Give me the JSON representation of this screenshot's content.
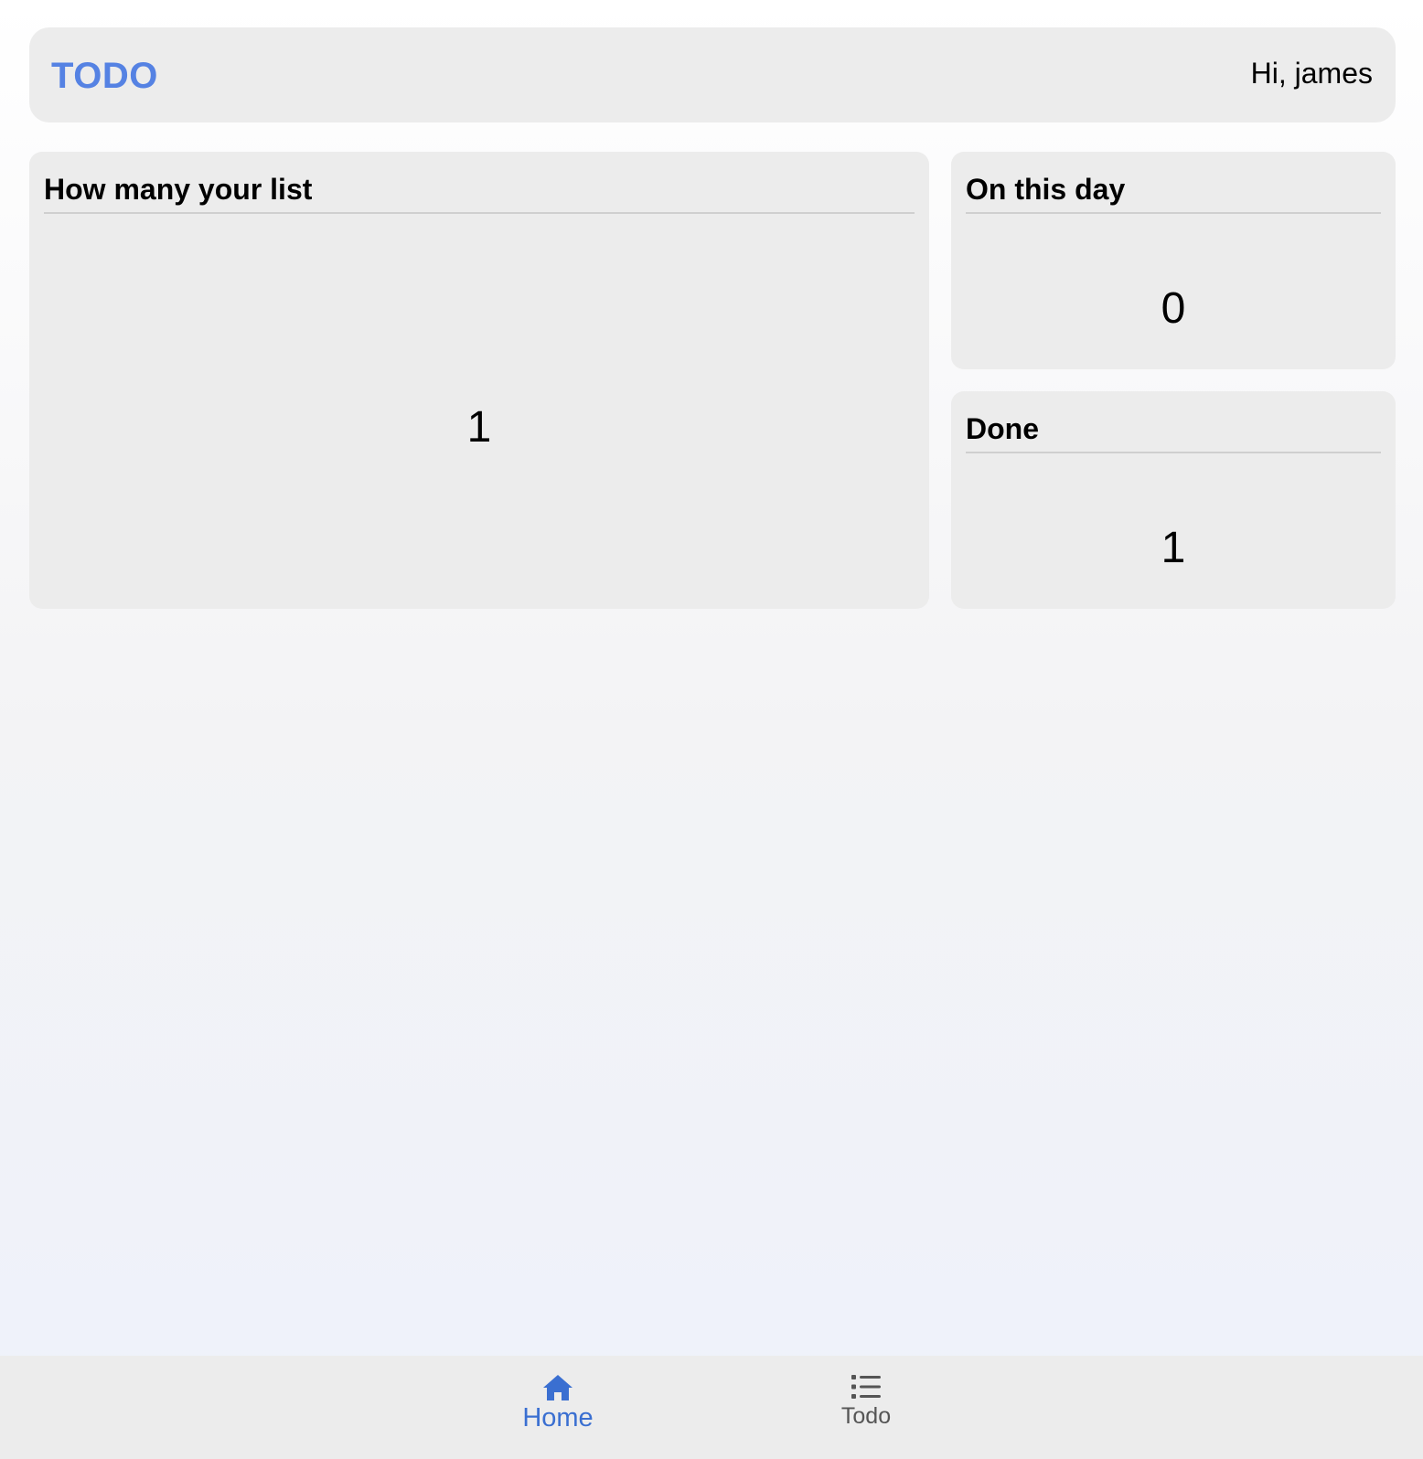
{
  "header": {
    "brand": "TODO",
    "greeting": "Hi, james"
  },
  "cards": {
    "list": {
      "title": "How many your list",
      "value": "1"
    },
    "today": {
      "title": "On this day",
      "value": "0"
    },
    "done": {
      "title": "Done",
      "value": "1"
    }
  },
  "tabbar": {
    "home": {
      "label": "Home",
      "icon": "house-icon",
      "active": true
    },
    "todo": {
      "label": "Todo",
      "icon": "list-icon",
      "active": false
    }
  },
  "colors": {
    "brand": "#5582e3",
    "active_tab": "#3a6fd1",
    "inactive_tab": "#555555",
    "card_bg": "#ececec"
  }
}
